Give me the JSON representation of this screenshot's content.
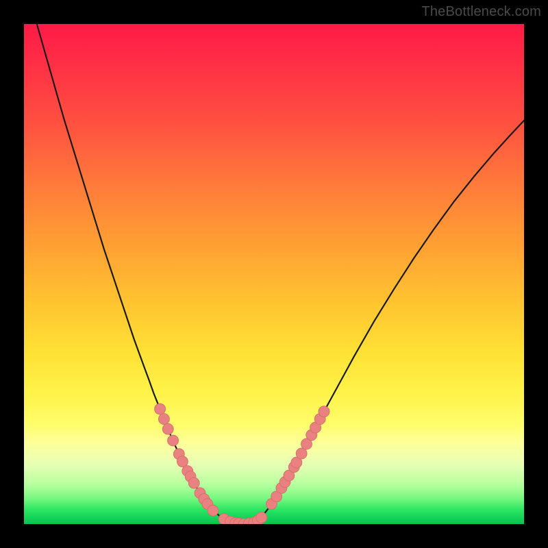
{
  "watermark": "TheBottleneck.com",
  "colors": {
    "curve_stroke": "#1a1a1a",
    "marker_fill": "#e8817f",
    "marker_stroke": "#d36a68"
  },
  "chart_data": {
    "type": "line",
    "title": "",
    "xlabel": "",
    "ylabel": "",
    "xlim": [
      0,
      1
    ],
    "ylim": [
      0,
      1
    ],
    "x": [
      0.0,
      0.02,
      0.04,
      0.06,
      0.08,
      0.1,
      0.12,
      0.14,
      0.16,
      0.18,
      0.2,
      0.22,
      0.24,
      0.25,
      0.26,
      0.27,
      0.28,
      0.29,
      0.3,
      0.31,
      0.32,
      0.33,
      0.34,
      0.35,
      0.36,
      0.37,
      0.38,
      0.39,
      0.4,
      0.41,
      0.42,
      0.43,
      0.44,
      0.45,
      0.46,
      0.47,
      0.48,
      0.49,
      0.5,
      0.52,
      0.54,
      0.56,
      0.58,
      0.6,
      0.63,
      0.66,
      0.7,
      0.74,
      0.78,
      0.82,
      0.86,
      0.9,
      0.94,
      0.97,
      1.0
    ],
    "values": [
      1.09,
      1.02,
      0.95,
      0.88,
      0.81,
      0.745,
      0.68,
      0.615,
      0.55,
      0.49,
      0.43,
      0.37,
      0.315,
      0.288,
      0.26,
      0.235,
      0.21,
      0.185,
      0.162,
      0.14,
      0.119,
      0.1,
      0.082,
      0.065,
      0.05,
      0.037,
      0.026,
      0.017,
      0.01,
      0.005,
      0.002,
      0.0,
      0.0,
      0.001,
      0.004,
      0.01,
      0.02,
      0.033,
      0.048,
      0.08,
      0.114,
      0.15,
      0.187,
      0.225,
      0.28,
      0.335,
      0.405,
      0.47,
      0.532,
      0.59,
      0.645,
      0.695,
      0.742,
      0.775,
      0.807
    ],
    "markers_left": [
      {
        "x": 0.272,
        "y": 0.23
      },
      {
        "x": 0.28,
        "y": 0.21
      },
      {
        "x": 0.288,
        "y": 0.19
      },
      {
        "x": 0.298,
        "y": 0.167
      },
      {
        "x": 0.31,
        "y": 0.14
      },
      {
        "x": 0.317,
        "y": 0.125
      },
      {
        "x": 0.327,
        "y": 0.106
      },
      {
        "x": 0.333,
        "y": 0.095
      },
      {
        "x": 0.34,
        "y": 0.082
      },
      {
        "x": 0.352,
        "y": 0.062
      },
      {
        "x": 0.36,
        "y": 0.05
      },
      {
        "x": 0.367,
        "y": 0.04
      },
      {
        "x": 0.378,
        "y": 0.027
      }
    ],
    "markers_bottom": [
      {
        "x": 0.4,
        "y": 0.01
      },
      {
        "x": 0.413,
        "y": 0.005
      },
      {
        "x": 0.423,
        "y": 0.002
      },
      {
        "x": 0.43,
        "y": 0.001
      },
      {
        "x": 0.44,
        "y": 0.0
      },
      {
        "x": 0.45,
        "y": 0.001
      },
      {
        "x": 0.46,
        "y": 0.003
      },
      {
        "x": 0.468,
        "y": 0.007
      },
      {
        "x": 0.475,
        "y": 0.013
      }
    ],
    "markers_right": [
      {
        "x": 0.495,
        "y": 0.04
      },
      {
        "x": 0.505,
        "y": 0.055
      },
      {
        "x": 0.515,
        "y": 0.072
      },
      {
        "x": 0.522,
        "y": 0.084
      },
      {
        "x": 0.53,
        "y": 0.097
      },
      {
        "x": 0.54,
        "y": 0.114
      },
      {
        "x": 0.545,
        "y": 0.123
      },
      {
        "x": 0.555,
        "y": 0.141
      },
      {
        "x": 0.565,
        "y": 0.16
      },
      {
        "x": 0.575,
        "y": 0.178
      },
      {
        "x": 0.583,
        "y": 0.193
      },
      {
        "x": 0.592,
        "y": 0.21
      },
      {
        "x": 0.6,
        "y": 0.225
      }
    ]
  }
}
